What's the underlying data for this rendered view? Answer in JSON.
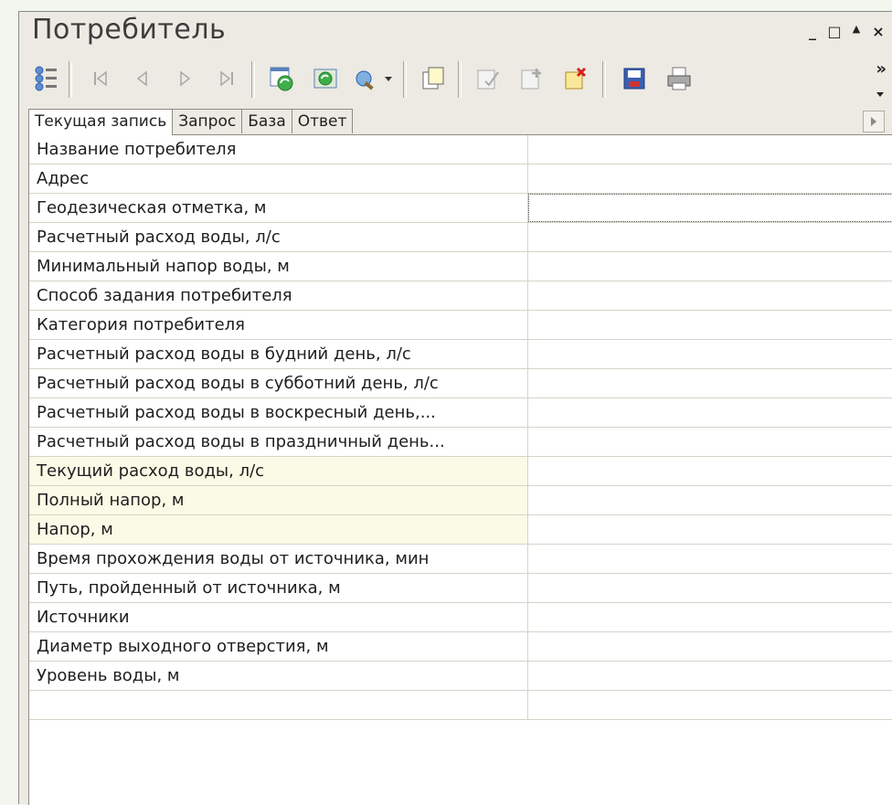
{
  "window": {
    "title": "Потребитель",
    "minimize": "_",
    "maximize": "□",
    "collapse": "▲",
    "close": "×",
    "overflow": "»"
  },
  "tabs": [
    {
      "label": "Текущая запись",
      "active": true
    },
    {
      "label": "Запрос",
      "active": false
    },
    {
      "label": "База",
      "active": false
    },
    {
      "label": "Ответ",
      "active": false
    }
  ],
  "rows": [
    {
      "label": "Название потребителя",
      "value": "",
      "calc": false
    },
    {
      "label": "Адрес",
      "value": "",
      "calc": false
    },
    {
      "label": "Геодезическая отметка, м",
      "value": "",
      "calc": false
    },
    {
      "label": "Расчетный расход воды, л/с",
      "value": "",
      "calc": false
    },
    {
      "label": "Минимальный напор воды, м",
      "value": "",
      "calc": false
    },
    {
      "label": "Способ задания потребителя",
      "value": "",
      "calc": false
    },
    {
      "label": "Категория потребителя",
      "value": "",
      "calc": false
    },
    {
      "label": "Расчетный расход воды в будний день, л/с",
      "value": "",
      "calc": false
    },
    {
      "label": "Расчетный расход воды в субботний день, л/с",
      "value": "",
      "calc": false
    },
    {
      "label": "Расчетный расход воды в воскресный день,...",
      "value": "",
      "calc": false
    },
    {
      "label": "Расчетный расход воды в праздничный день...",
      "value": "",
      "calc": false
    },
    {
      "label": "Текущий расход воды, л/с",
      "value": "",
      "calc": true
    },
    {
      "label": "Полный напор, м",
      "value": "",
      "calc": true
    },
    {
      "label": "Напор, м",
      "value": "",
      "calc": true
    },
    {
      "label": "Время прохождения воды от источника, мин",
      "value": "",
      "calc": false
    },
    {
      "label": "Путь, пройденный от источника, м",
      "value": "",
      "calc": false
    },
    {
      "label": "Источники",
      "value": "",
      "calc": false
    },
    {
      "label": "Диаметр выходного отверстия, м",
      "value": "",
      "calc": false
    },
    {
      "label": "Уровень воды, м",
      "value": "",
      "calc": false
    },
    {
      "label": "",
      "value": "",
      "calc": false
    }
  ],
  "colors": {
    "calc_row": "#fbfae6",
    "accent_blue": "#2a5db0",
    "accent_green": "#2f9a3a"
  }
}
